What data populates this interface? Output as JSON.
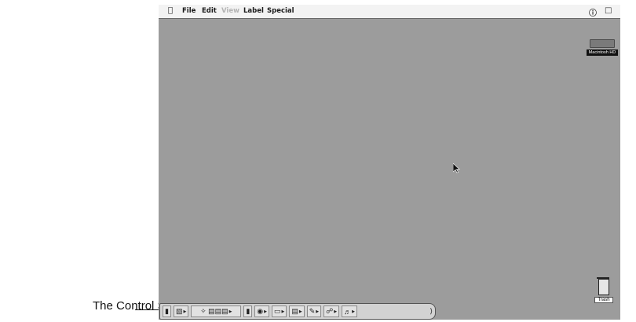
{
  "callout": {
    "label": "The Control Strip"
  },
  "menubar": {
    "apple_icon": "apple-logo-icon",
    "menus": [
      {
        "label": "File",
        "dimmed": false
      },
      {
        "label": "Edit",
        "dimmed": false
      },
      {
        "label": "View",
        "dimmed": true
      },
      {
        "label": "Label",
        "dimmed": false
      },
      {
        "label": "Special",
        "dimmed": false
      }
    ],
    "right_icons": [
      "help-icon",
      "application-menu-icon"
    ]
  },
  "desktop": {
    "hard_disk": {
      "label": "Macintosh HD"
    },
    "trash": {
      "label": "Trash"
    }
  },
  "control_strip": {
    "modules": [
      {
        "icon": "strip-collapse-tab-icon"
      },
      {
        "icon": "monitor-bit-depth-icon"
      },
      {
        "icon": "appletalk-switch-icon"
      },
      {
        "icon": "battery-monitor-icon"
      },
      {
        "icon": "cd-player-icon"
      },
      {
        "icon": "monitor-resolution-icon"
      },
      {
        "icon": "printer-selector-icon"
      },
      {
        "icon": "file-sharing-icon"
      },
      {
        "icon": "power-settings-icon"
      },
      {
        "icon": "sound-volume-icon"
      }
    ]
  }
}
